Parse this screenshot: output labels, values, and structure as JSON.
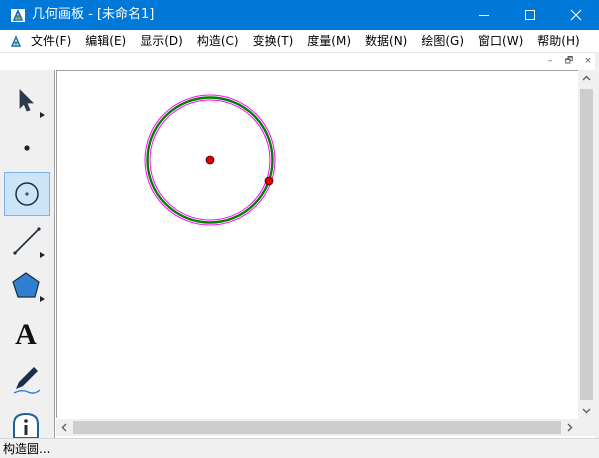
{
  "window": {
    "title": "几何画板 - [未命名1]",
    "accent": "#0078d7",
    "controls": {
      "minimize": "minimize-icon",
      "maximize": "maximize-icon",
      "close": "close-icon"
    }
  },
  "menubar": {
    "items": [
      {
        "label": "文件(F)"
      },
      {
        "label": "编辑(E)"
      },
      {
        "label": "显示(D)"
      },
      {
        "label": "构造(C)"
      },
      {
        "label": "变换(T)"
      },
      {
        "label": "度量(M)"
      },
      {
        "label": "数据(N)"
      },
      {
        "label": "绘图(G)"
      },
      {
        "label": "窗口(W)"
      },
      {
        "label": "帮助(H)"
      }
    ]
  },
  "mdi_controls": {
    "minimize": "–",
    "restore": "🗗",
    "close": "×"
  },
  "toolbox": {
    "tools": [
      {
        "name": "arrow-select-tool",
        "icon": "arrow-icon",
        "active": false
      },
      {
        "name": "point-tool",
        "icon": "point-icon",
        "active": false
      },
      {
        "name": "compass-tool",
        "icon": "circle-icon",
        "active": true
      },
      {
        "name": "straightedge-tool",
        "icon": "line-segment-icon",
        "active": false
      },
      {
        "name": "polygon-tool",
        "icon": "pentagon-icon",
        "active": false
      },
      {
        "name": "text-tool",
        "icon": "text-A-icon",
        "label": "A",
        "active": false
      },
      {
        "name": "marker-tool",
        "icon": "pen-icon",
        "active": false
      },
      {
        "name": "information-tool",
        "icon": "info-icon",
        "active": false
      }
    ]
  },
  "canvas": {
    "circle_colors": {
      "highlight": "#ff00ff",
      "stroke": "#008000"
    },
    "point_color": "#e00000"
  },
  "statusbar": {
    "text": "构造圆..."
  }
}
